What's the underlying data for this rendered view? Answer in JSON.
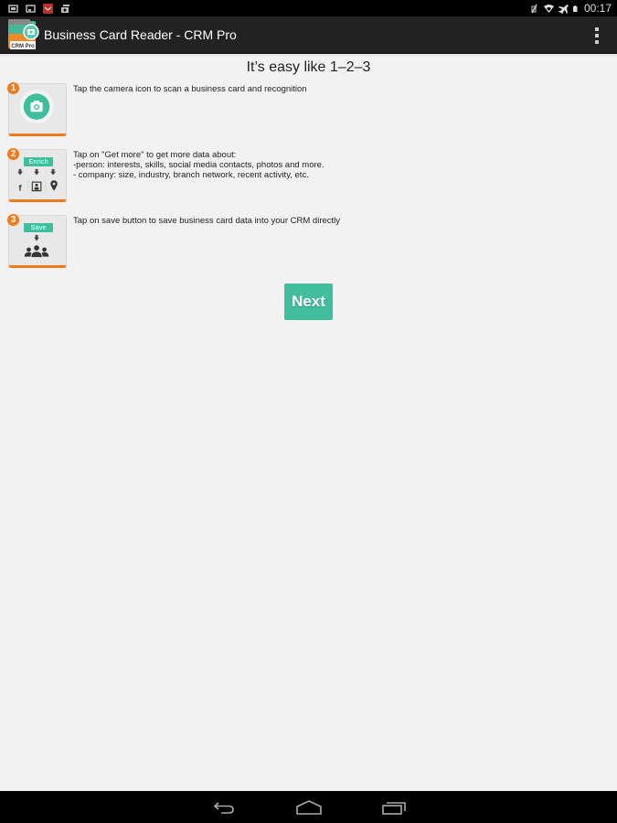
{
  "status_bar": {
    "left_icons": [
      "gallery-icon",
      "image-icon",
      "mail-app-icon",
      "photo-stack-icon"
    ],
    "right_icons": [
      "no-vibrate-icon",
      "wifi-icon",
      "airplane-mode-icon",
      "battery-icon"
    ],
    "time": "00:17"
  },
  "action_bar": {
    "app_icon_label": "CRM Pro",
    "title": "Business Card Reader - CRM Pro",
    "overflow_icon": "overflow-menu-icon"
  },
  "main": {
    "heading": "It’s easy like 1–2–3",
    "steps": [
      {
        "number": "1",
        "icon": "camera-icon",
        "lines": [
          "Tap the camera icon to scan a business card and recognition"
        ]
      },
      {
        "number": "2",
        "icon_label": "Enrich",
        "sub_icons": [
          "facebook-icon",
          "contact-card-icon",
          "location-pin-icon"
        ],
        "lines": [
          "Tap on \"Get more\" to get more data about:",
          "-person: interests, skills, social media contacts, photos and more.",
          "- company: size, industry, branch network, recent activity, etc."
        ]
      },
      {
        "number": "3",
        "icon_label": "Save",
        "sub_icons": [
          "people-group-icon"
        ],
        "lines": [
          "Tap on save button to save business card data into your CRM directly"
        ]
      }
    ],
    "next_button": "Next"
  },
  "nav_bar": {
    "buttons": [
      "back",
      "home",
      "recent-apps"
    ]
  },
  "colors": {
    "accent": "#42bd9d",
    "badge": "#ee7c1d",
    "action_bar": "#222222",
    "background": "#f2f2f2"
  }
}
